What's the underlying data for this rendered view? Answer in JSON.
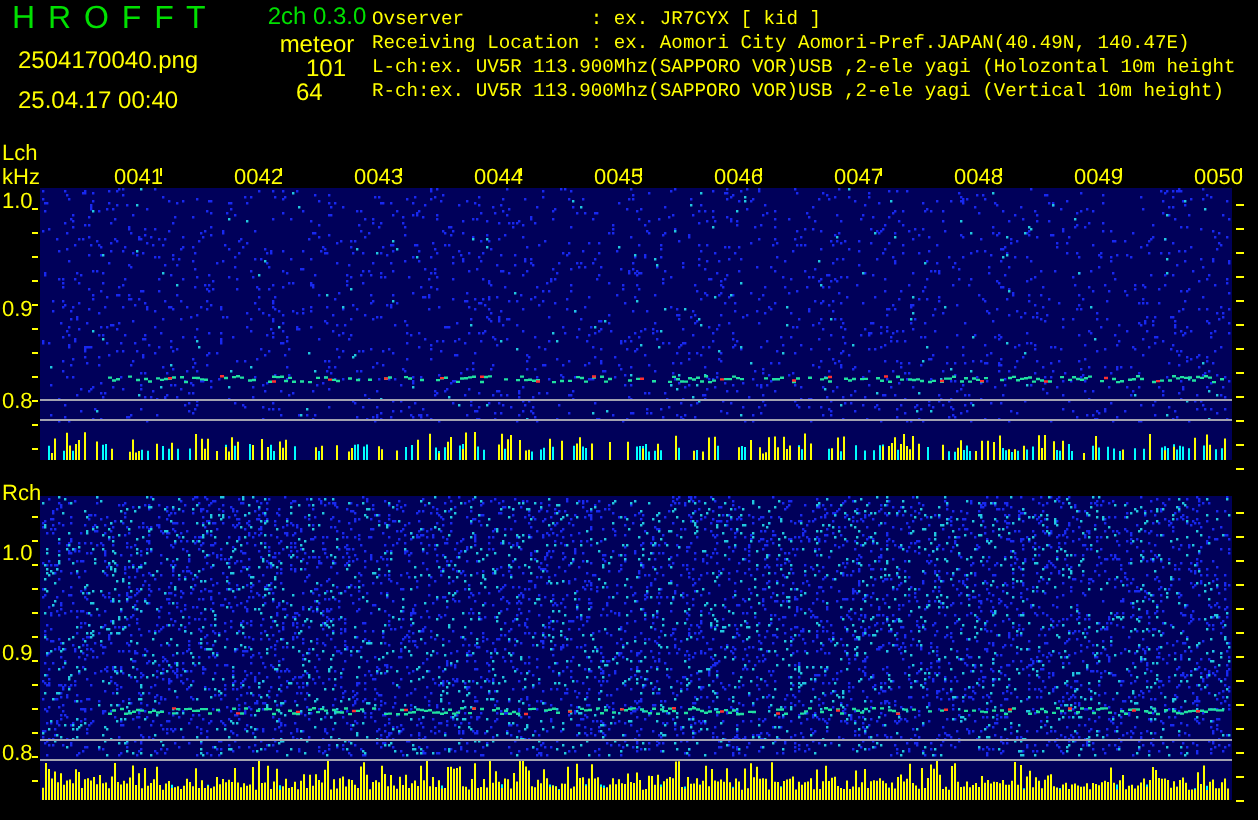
{
  "header": {
    "app_name": "H R O F F T",
    "version": "2ch 0.3.0",
    "filename": "2504170040.png",
    "datetime": "25.04.17 00:40",
    "meteor_label": "meteor",
    "meteor_counts": [
      "101",
      "64"
    ],
    "info_lines": [
      "Ovserver           : ex. JR7CYX [ kid ]",
      "Receiving Location : ex. Aomori City Aomori-Pref.JAPAN(40.49N, 140.47E)",
      "L-ch:ex. UV5R 113.900Mhz(SAPPORO VOR)USB ,2-ele yagi (Holozontal 10m height",
      "R-ch:ex. UV5R 113.900Mhz(SAPPORO VOR)USB ,2-ele yagi (Vertical 10m height)"
    ]
  },
  "panels": [
    {
      "channel": "Lch",
      "unit": "kHz",
      "time_labels": [
        "0041",
        "0042",
        "0043",
        "0044",
        "0045",
        "0046",
        "0047",
        "0048",
        "0049",
        "0050"
      ],
      "yticks": [
        "1.0",
        "0.9",
        "0.8"
      ]
    },
    {
      "channel": "Rch",
      "yticks": [
        "1.0",
        "0.9",
        "0.8"
      ]
    }
  ]
}
